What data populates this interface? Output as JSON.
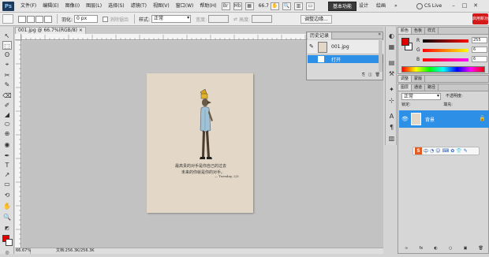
{
  "menubar": {
    "logo": "Ps",
    "items": [
      "文件(F)",
      "编辑(E)",
      "图像(I)",
      "图层(L)",
      "选择(S)",
      "滤镜(T)",
      "视图(V)",
      "窗口(W)",
      "帮助(H)"
    ],
    "zoom": "66.7",
    "workspaces": {
      "basic": "基本功能",
      "design": "设计",
      "paint": "绘画",
      "more": "»"
    },
    "cslive": "CS Live",
    "window_controls": {
      "minimize": "–",
      "restore": "□",
      "close": "✕"
    }
  },
  "options": {
    "feather_label": "羽化:",
    "feather_value": "0 px",
    "antialias_label": "消除锯齿",
    "style_label": "样式:",
    "style_value": "正常",
    "width_label": "宽度:",
    "height_label": "高度:",
    "refine_label": "调整边缘..."
  },
  "badge": "启用新功能",
  "document": {
    "tab_title": "001.jpg @ 66.7%(RGB/8) ×",
    "caption_line1": "最高贵的对手是你自己的过去",
    "caption_line2": "未来的你就是你的对手。",
    "signature": "— Tuesday, 2/3"
  },
  "status": {
    "zoom": "66.67%",
    "doc_info": "文档:256.3K/256.3K"
  },
  "history": {
    "tab_label": "历史记录",
    "close_label": "»",
    "snapshot_label": "001.jpg",
    "state_label": "打开",
    "footer_icons": [
      "⎘",
      "◫",
      "🗑"
    ]
  },
  "color_panel": {
    "tabs": [
      "颜色",
      "色板",
      "样式"
    ],
    "r_label": "R",
    "r_value": "255",
    "g_label": "G",
    "g_value": "6",
    "b_label": "B",
    "b_value": "6",
    "fg_color": "#e00000"
  },
  "adjust_panel": {
    "tabs": [
      "调整",
      "蒙版"
    ]
  },
  "layers_panel": {
    "tabs": [
      "图层",
      "通道",
      "路径"
    ],
    "blend_mode": "正常",
    "opacity": "不透明度:",
    "lock_label": "锁定:",
    "fill_label": "填充:",
    "layer_name": "背景",
    "footer_icons": [
      "∞",
      "fx",
      "◐",
      "○",
      "▣",
      "🗑"
    ]
  },
  "ime": {
    "logo": "S",
    "items": [
      "中",
      "◔",
      "☺",
      "⌨",
      "✿",
      "👕",
      "✎"
    ]
  },
  "tools": [
    "↖",
    "⬚",
    "ʘ",
    "⌖",
    "✂",
    "✎",
    "⌫",
    "✐",
    "◢",
    "⬭",
    "⊕",
    "T",
    "↗",
    "▭",
    "✋",
    "🔍"
  ],
  "strip_icons": [
    "◐",
    "▦",
    "▤",
    "⚒",
    "✦",
    "⊹",
    "A",
    "¶",
    "▥"
  ]
}
